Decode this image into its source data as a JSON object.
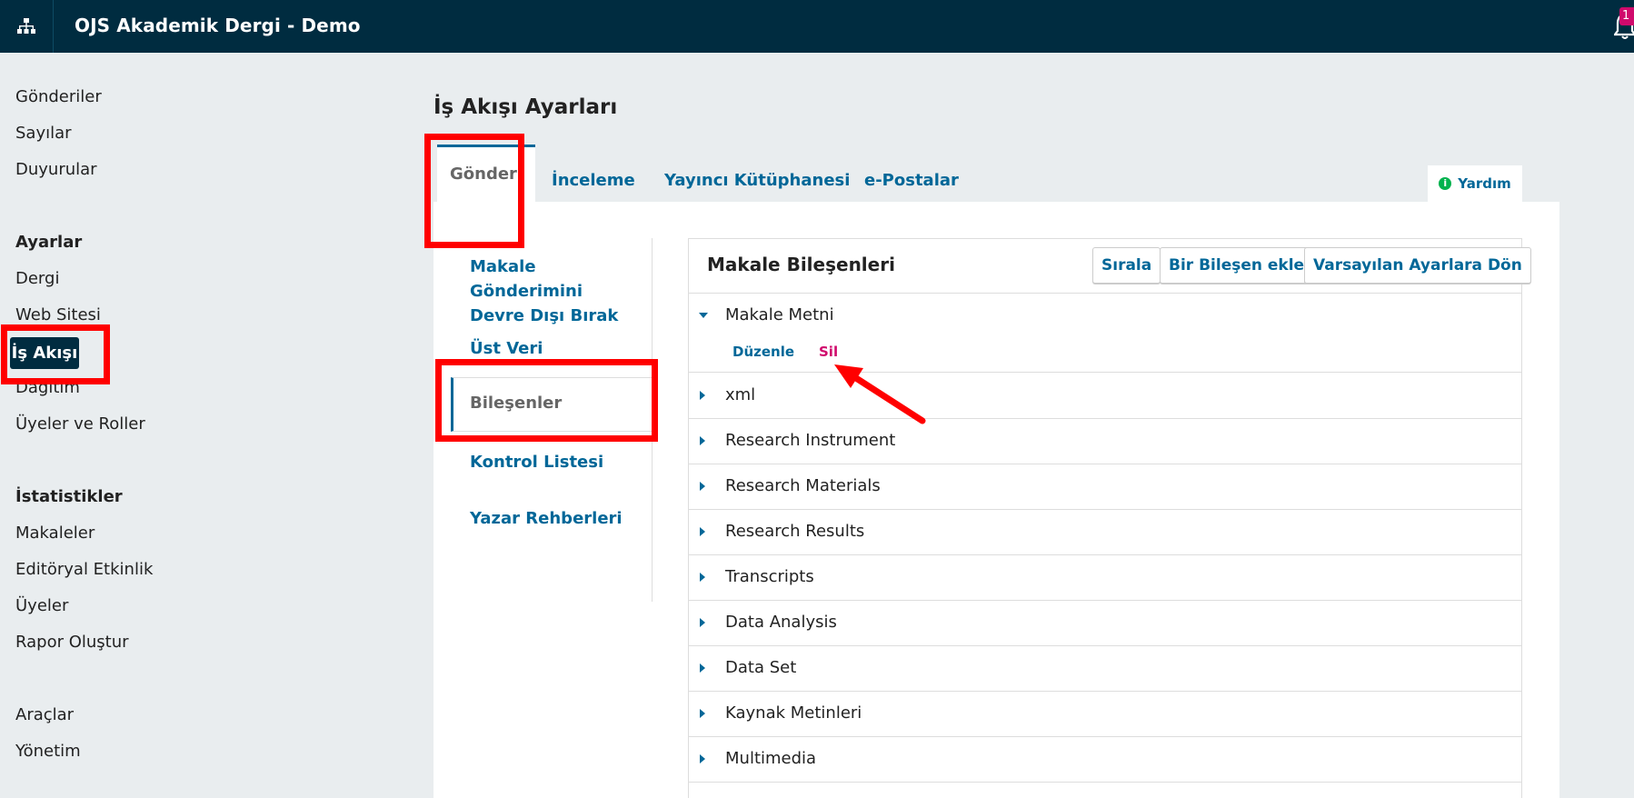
{
  "header": {
    "site_title": "OJS Akademik Dergi - Demo",
    "notification_count": "1"
  },
  "sidebar": {
    "items_top": [
      "Gönderiler",
      "Sayılar",
      "Duyurular"
    ],
    "settings_heading": "Ayarlar",
    "settings_items": [
      "Dergi",
      "Web Sitesi",
      "İş Akışı",
      "Dağıtım",
      "Üyeler ve Roller"
    ],
    "stats_heading": "İstatistikler",
    "stats_items": [
      "Makaleler",
      "Editöryal Etkinlik",
      "Üyeler",
      "Rapor Oluştur"
    ],
    "bottom_items": [
      "Araçlar",
      "Yönetim"
    ]
  },
  "main": {
    "page_title": "İş Akışı Ayarları",
    "tabs": [
      "Gönderi",
      "İnceleme",
      "Yayıncı Kütüphanesi",
      "e-Postalar"
    ],
    "help_label": "Yardım",
    "subnav": [
      "Makale Gönderimini Devre Dışı Bırak",
      "Üst Veri",
      "Bileşenler",
      "Kontrol Listesi",
      "Yazar Rehberleri"
    ]
  },
  "grid": {
    "title": "Makale Bileşenleri",
    "buttons": [
      "Sırala",
      "Bir Bileşen ekle",
      "Varsayılan Ayarlara Dön"
    ],
    "expanded_row": "Makale Metni",
    "row_actions": [
      "Düzenle",
      "Sil"
    ],
    "rows": [
      "xml",
      "Research Instrument",
      "Research Materials",
      "Research Results",
      "Transcripts",
      "Data Analysis",
      "Data Set",
      "Kaynak Metinleri",
      "Multimedia"
    ]
  },
  "colors": {
    "header_bg": "#002c40",
    "link": "#006798",
    "delete": "#d00a6c",
    "highlight": "#ff0000",
    "help_icon": "#00b24e"
  },
  "icons": [
    "sitemap-icon",
    "bell-icon",
    "info-icon",
    "caret-right-icon",
    "caret-down-icon",
    "red-arrow-annotation"
  ]
}
